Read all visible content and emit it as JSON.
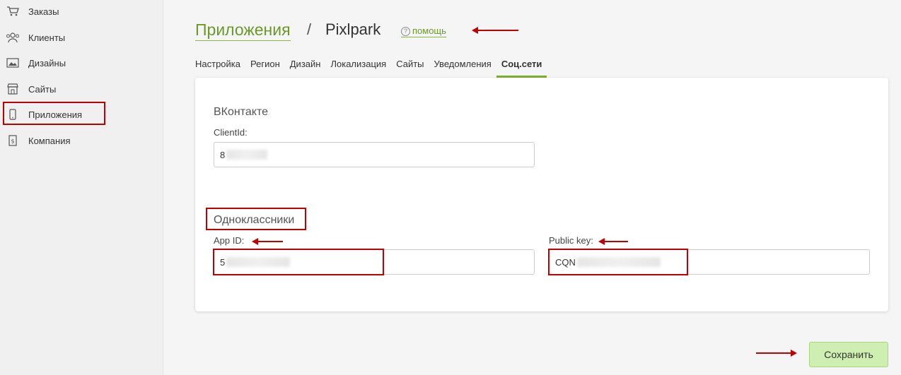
{
  "sidebar": {
    "items": [
      {
        "label": "Заказы",
        "icon": "cart-icon"
      },
      {
        "label": "Клиенты",
        "icon": "users-icon"
      },
      {
        "label": "Дизайны",
        "icon": "image-icon"
      },
      {
        "label": "Сайты",
        "icon": "store-icon"
      },
      {
        "label": "Приложения",
        "icon": "phone-icon"
      },
      {
        "label": "Компания",
        "icon": "document-icon"
      }
    ],
    "active": "Приложения"
  },
  "header": {
    "breadcrumb_root": "Приложения",
    "separator": "/",
    "current": "Pixlpark",
    "help_label": "помощь"
  },
  "tabs": [
    {
      "label": "Настройка"
    },
    {
      "label": "Регион"
    },
    {
      "label": "Дизайн"
    },
    {
      "label": "Локализация"
    },
    {
      "label": "Сайты"
    },
    {
      "label": "Уведомления"
    },
    {
      "label": "Соц.сети"
    }
  ],
  "active_tab": "Соц.сети",
  "vk": {
    "title": "ВКонтакте",
    "client_id_label": "ClientId:",
    "client_id_value": "8"
  },
  "ok": {
    "title": "Одноклассники",
    "app_id_label": "App ID:",
    "app_id_value": "5",
    "public_key_label": "Public key:",
    "public_key_value": "CQN"
  },
  "actions": {
    "save_label": "Сохранить"
  },
  "colors": {
    "accent": "#7bb02b",
    "link": "#6a9a2a",
    "annotation": "#c00000",
    "save_bg": "#cfeeb2"
  }
}
